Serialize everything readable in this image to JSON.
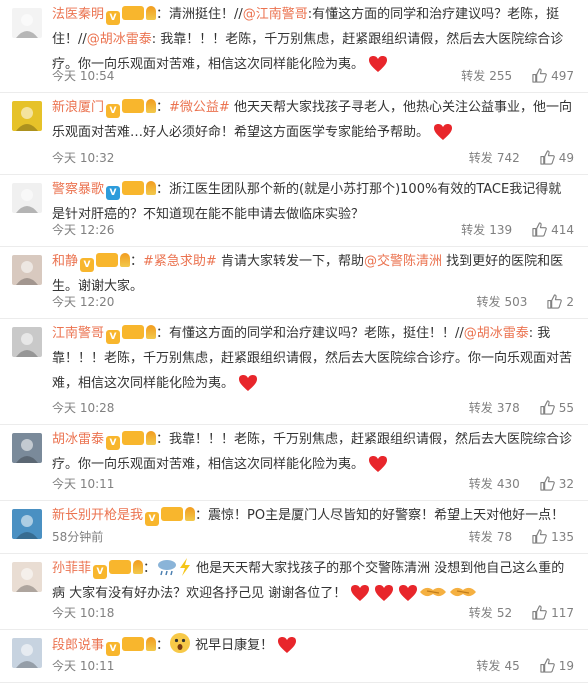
{
  "repost_label": "转发",
  "comments": [
    {
      "name": "法医秦明",
      "parts": [
        {
          "t": "：清洲挺住！//"
        },
        {
          "m": "@江南警哥"
        },
        {
          "t": ":有懂这方面的同学和治疗建议吗？老陈，挺住！//"
        },
        {
          "m": "@胡冰雷泰"
        },
        {
          "t": ": 我靠！！！老陈，千万别焦虑，赶紧跟组织请假，然后去大医院综合诊疗。你一向乐观面对苦难，相信这次同样能化险为夷。"
        },
        {
          "e": "heart"
        }
      ],
      "time": "今天 10:54",
      "reposts": "255",
      "likes": "497"
    },
    {
      "name": "新浪厦门",
      "parts": [
        {
          "t": "："
        },
        {
          "m": "#微公益#"
        },
        {
          "t": " 他天天帮大家找孩子寻老人，他热心关注公益事业，他一向乐观面对苦难…好人必须好命！希望这方面医学专家能给予帮助。"
        },
        {
          "e": "heart"
        }
      ],
      "time": "今天 10:32",
      "reposts": "742",
      "likes": "49"
    },
    {
      "name": "警察暴歌",
      "parts": [
        {
          "t": "：浙江医生团队那个新的(就是小苏打那个)100%有效的TACE我记得就是针对肝癌的？不知道现在能不能申请去做临床实验？"
        }
      ],
      "time": "今天 12:26",
      "reposts": "139",
      "likes": "414"
    },
    {
      "name": "和静",
      "parts": [
        {
          "t": "："
        },
        {
          "m": "#紧急求助#"
        },
        {
          "t": " 肯请大家转发一下，帮助"
        },
        {
          "m": "@交警陈清洲"
        },
        {
          "t": " 找到更好的医院和医生。谢谢大家。"
        }
      ],
      "time": "今天 12:20",
      "reposts": "503",
      "likes": "2"
    },
    {
      "name": "江南警哥",
      "parts": [
        {
          "t": "：有懂这方面的同学和治疗建议吗？老陈，挺住！！//"
        },
        {
          "m": "@胡冰雷泰"
        },
        {
          "t": ": 我靠！！！老陈，千万别焦虑，赶紧跟组织请假，然后去大医院综合诊疗。你一向乐观面对苦难，相信这次同样能化险为夷。"
        },
        {
          "e": "heart"
        }
      ],
      "time": "今天 10:28",
      "reposts": "378",
      "likes": "55"
    },
    {
      "name": "胡冰雷泰",
      "parts": [
        {
          "t": "：我靠！！！老陈，千万别焦虑，赶紧跟组织请假，然后去大医院综合诊疗。你一向乐观面对苦难，相信这次同样能化险为夷。"
        },
        {
          "e": "heart"
        }
      ],
      "time": "今天 10:11",
      "reposts": "430",
      "likes": "32"
    },
    {
      "name": "新长别开枪是我",
      "parts": [
        {
          "t": "：震惊！PO主是厦门人尽皆知的好警察！希望上天对他好一点！"
        }
      ],
      "time": "58分钟前",
      "reposts": "78",
      "likes": "135"
    },
    {
      "name": "孙菲菲",
      "parts": [
        {
          "t": "："
        },
        {
          "e": "cloud"
        },
        {
          "e": "bolt"
        },
        {
          "t": " 他是天天帮大家找孩子的那个交警陈清洲 没想到他自己这么重的病 大家有没有好办法？欢迎各抒己见 谢谢各位了！"
        },
        {
          "e": "heart"
        },
        {
          "e": "heart"
        },
        {
          "e": "heart"
        },
        {
          "e": "hands"
        },
        {
          "e": "hands"
        }
      ],
      "time": "今天 10:18",
      "reposts": "52",
      "likes": "117"
    },
    {
      "name": "段郎说事",
      "parts": [
        {
          "t": "："
        },
        {
          "e": "wow"
        },
        {
          "t": " 祝早日康复！"
        },
        {
          "e": "heart"
        }
      ],
      "time": "今天 10:11",
      "reposts": "45",
      "likes": "19"
    }
  ]
}
